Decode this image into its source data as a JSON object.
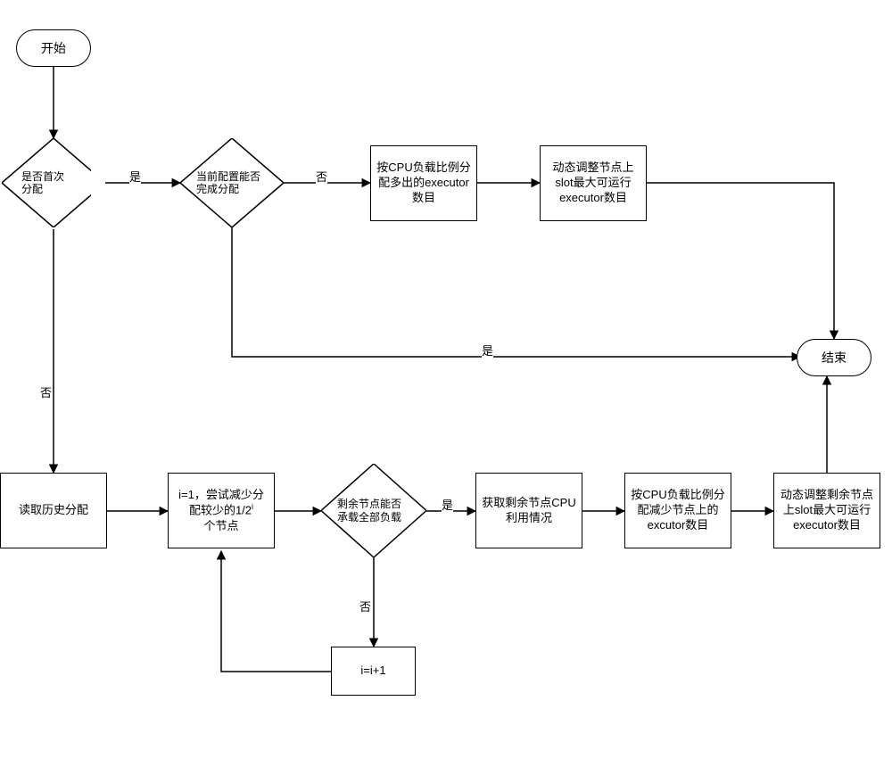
{
  "chart_data": {
    "type": "flowchart",
    "nodes": [
      {
        "id": "start",
        "type": "terminator",
        "label": "开始"
      },
      {
        "id": "d1",
        "type": "decision",
        "label": "是否首次分配"
      },
      {
        "id": "d2",
        "type": "decision",
        "label": "当前配置能否完成分配"
      },
      {
        "id": "p1",
        "type": "process",
        "label": "按CPU负载比例分配多出的executor数目"
      },
      {
        "id": "p2",
        "type": "process",
        "label": "动态调整节点上slot最大可运行executor数目"
      },
      {
        "id": "end",
        "type": "terminator",
        "label": "结束"
      },
      {
        "id": "p3",
        "type": "process",
        "label": "读取历史分配"
      },
      {
        "id": "p4",
        "type": "process",
        "label": "i=1，尝试减少分配较少的1/2ⁱ个节点"
      },
      {
        "id": "d3",
        "type": "decision",
        "label": "剩余节点能否承载全部负载"
      },
      {
        "id": "p5",
        "type": "process",
        "label": "获取剩余节点CPU利用情况"
      },
      {
        "id": "p6",
        "type": "process",
        "label": "按CPU负载比例分配减少节点上的excutor数目"
      },
      {
        "id": "p7",
        "type": "process",
        "label": "动态调整剩余节点上slot最大可运行executor数目"
      },
      {
        "id": "p8",
        "type": "process",
        "label": "i=i+1"
      }
    ],
    "edges": [
      {
        "from": "start",
        "to": "d1"
      },
      {
        "from": "d1",
        "to": "d2",
        "label": "是"
      },
      {
        "from": "d1",
        "to": "p3",
        "label": "否"
      },
      {
        "from": "d2",
        "to": "p1",
        "label": "否"
      },
      {
        "from": "d2",
        "to": "end",
        "label": "是"
      },
      {
        "from": "p1",
        "to": "p2"
      },
      {
        "from": "p2",
        "to": "end"
      },
      {
        "from": "p3",
        "to": "p4"
      },
      {
        "from": "p4",
        "to": "d3"
      },
      {
        "from": "d3",
        "to": "p5",
        "label": "是"
      },
      {
        "from": "d3",
        "to": "p8",
        "label": "否"
      },
      {
        "from": "p8",
        "to": "p4"
      },
      {
        "from": "p5",
        "to": "p6"
      },
      {
        "from": "p6",
        "to": "p7"
      },
      {
        "from": "p7",
        "to": "end"
      }
    ]
  },
  "labels": {
    "start": "开始",
    "end": "结束",
    "d1": "是否首次分配",
    "d2": "当前配置能否完成分配",
    "d3": "剩余节点能否承载全部负载",
    "p1": "按CPU负载比例分配多出的executor数目",
    "p2": "动态调整节点上slot最大可运行executor数目",
    "p3": "读取历史分配",
    "p4_a": "i=1，尝试减少分",
    "p4_b": "配较少的1/2",
    "p4_c": "个节点",
    "p5": "获取剩余节点CPU利用情况",
    "p6": "按CPU负载比例分配减少节点上的excutor数目",
    "p7": "动态调整剩余节点上slot最大可运行executor数目",
    "p8": "i=i+1",
    "yes": "是",
    "no": "否"
  }
}
